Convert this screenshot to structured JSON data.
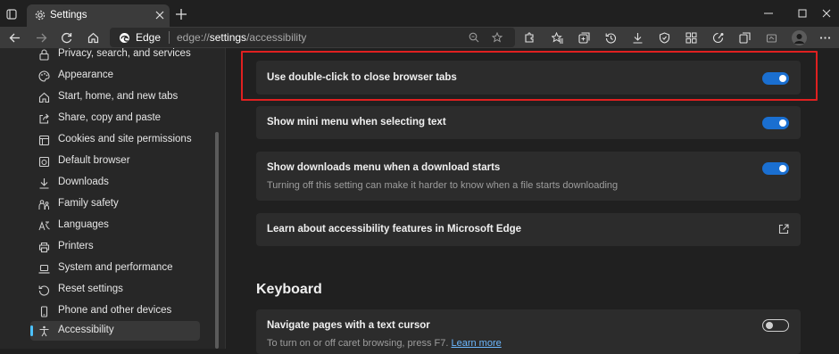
{
  "tab": {
    "title": "Settings"
  },
  "address": {
    "site_label": "Edge",
    "url_prefix": "edge://",
    "url_strong": "settings",
    "url_suffix": "/accessibility"
  },
  "sidebar": {
    "items": [
      {
        "label": "Privacy, search, and services",
        "icon": "lock-icon"
      },
      {
        "label": "Appearance",
        "icon": "palette-icon"
      },
      {
        "label": "Start, home, and new tabs",
        "icon": "home-icon"
      },
      {
        "label": "Share, copy and paste",
        "icon": "share-icon"
      },
      {
        "label": "Cookies and site permissions",
        "icon": "cookie-icon"
      },
      {
        "label": "Default browser",
        "icon": "browser-icon"
      },
      {
        "label": "Downloads",
        "icon": "download-icon"
      },
      {
        "label": "Family safety",
        "icon": "family-icon"
      },
      {
        "label": "Languages",
        "icon": "language-icon"
      },
      {
        "label": "Printers",
        "icon": "printer-icon"
      },
      {
        "label": "System and performance",
        "icon": "laptop-icon"
      },
      {
        "label": "Reset settings",
        "icon": "reset-icon"
      },
      {
        "label": "Phone and other devices",
        "icon": "phone-icon"
      },
      {
        "label": "Accessibility",
        "icon": "accessibility-icon",
        "active": true
      }
    ]
  },
  "settings": {
    "double_click": {
      "title": "Use double-click to close browser tabs",
      "enabled": true
    },
    "mini_menu": {
      "title": "Show mini menu when selecting text",
      "enabled": true
    },
    "downloads_menu": {
      "title": "Show downloads menu when a download starts",
      "description": "Turning off this setting can make it harder to know when a file starts downloading",
      "enabled": true
    },
    "learn_more": {
      "title": "Learn about accessibility features in Microsoft Edge"
    }
  },
  "keyboard": {
    "heading": "Keyboard",
    "caret": {
      "title": "Navigate pages with a text cursor",
      "description": "To turn on or off caret browsing, press F7.",
      "link": "Learn more",
      "enabled": false
    }
  },
  "colors": {
    "accent": "#1a6fd1",
    "highlight": "#e02020",
    "link": "#6cb8ff"
  }
}
